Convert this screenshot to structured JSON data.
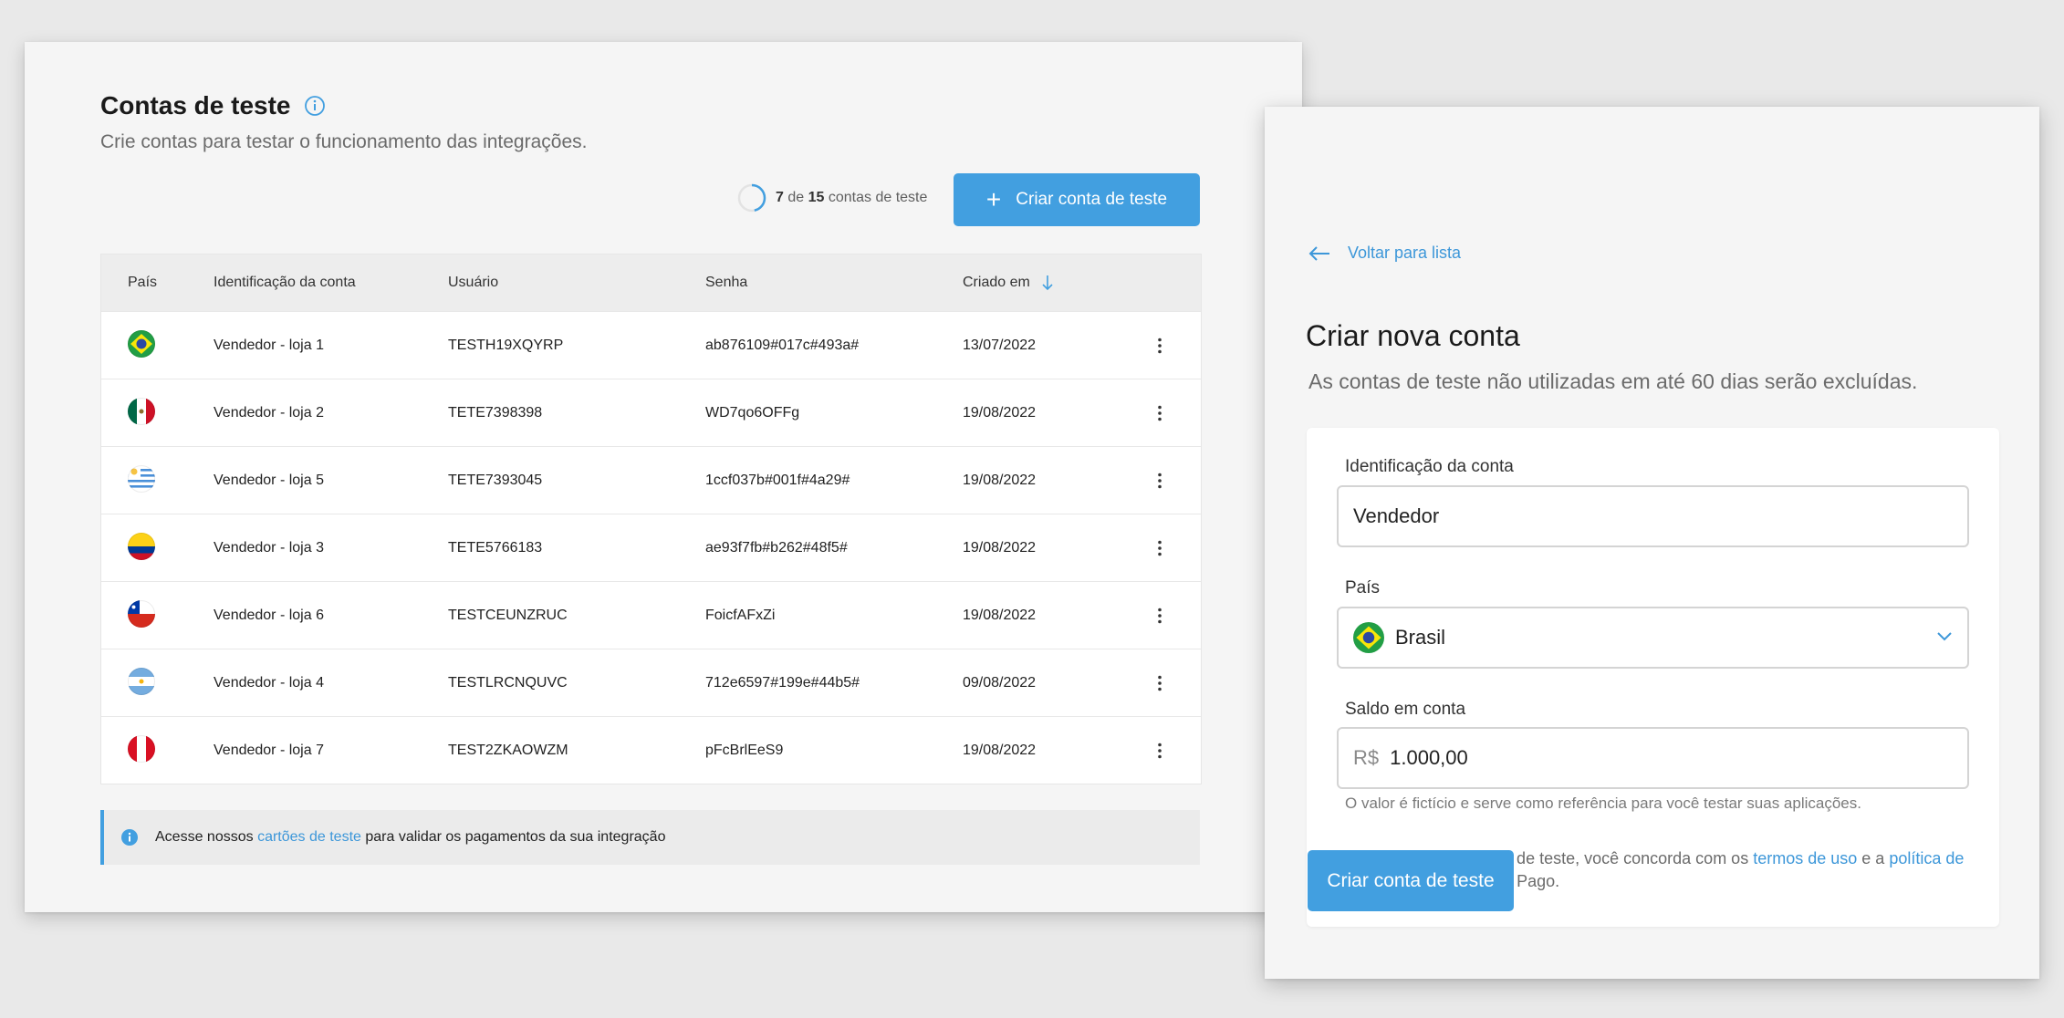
{
  "list": {
    "title": "Contas de teste",
    "subtitle": "Crie contas para testar o funcionamento das integrações.",
    "counter": {
      "current": "7",
      "of": "de",
      "total": "15",
      "suffix": "contas de teste",
      "progress_fraction": 0.4667
    },
    "create_button": "Criar conta de teste",
    "columns": [
      "País",
      "Identificação da conta",
      "Usuário",
      "Senha",
      "Criado em"
    ],
    "rows": [
      {
        "country": "BR",
        "name": "Vendedor - loja 1",
        "user": "TESTH19XQYRP",
        "password": "ab876109#017c#493a#",
        "created": "13/07/2022"
      },
      {
        "country": "MX",
        "name": "Vendedor - loja 2",
        "user": "TETE7398398",
        "password": "WD7qo6OFFg",
        "created": "19/08/2022"
      },
      {
        "country": "UY",
        "name": "Vendedor - loja 5",
        "user": "TETE7393045",
        "password": "1ccf037b#001f#4a29#",
        "created": "19/08/2022"
      },
      {
        "country": "CO",
        "name": "Vendedor - loja 3",
        "user": "TETE5766183",
        "password": "ae93f7fb#b262#48f5#",
        "created": "19/08/2022"
      },
      {
        "country": "CL",
        "name": "Vendedor - loja 6",
        "user": "TESTCEUNZRUC",
        "password": "FoicfAFxZi",
        "created": "19/08/2022"
      },
      {
        "country": "AR",
        "name": "Vendedor - loja 4",
        "user": "TESTLRCNQUVC",
        "password": "712e6597#199e#44b5#",
        "created": "09/08/2022"
      },
      {
        "country": "PE",
        "name": "Vendedor - loja 7",
        "user": "TEST2ZKAOWZM",
        "password": "pFcBrlEeS9",
        "created": "19/08/2022"
      }
    ],
    "notice": {
      "before": "Acesse nossos",
      "link": "cartões de teste",
      "after": "para validar os pagamentos da sua integração"
    }
  },
  "form": {
    "back_label": "Voltar para lista",
    "title": "Criar nova conta",
    "subtitle": "As contas de teste não utilizadas em até 60 dias serão excluídas.",
    "id_label": "Identificação da conta",
    "id_value": "Vendedor",
    "country_label": "País",
    "country_value": "Brasil",
    "balance_label": "Saldo em conta",
    "currency": "R$",
    "balance_value": "1.000,00",
    "balance_help": "O valor é fictício e serve como referência para você testar suas aplicações.",
    "terms": {
      "before": "Ao clicar em Criar conta de teste, você concorda com os",
      "link1": "termos de uso",
      "mid": "e a",
      "link2": "política de privacidade",
      "after": "do Mercado Pago."
    },
    "submit": "Criar conta de teste"
  },
  "colors": {
    "accent": "#429fe0",
    "link": "#3d97d9"
  }
}
